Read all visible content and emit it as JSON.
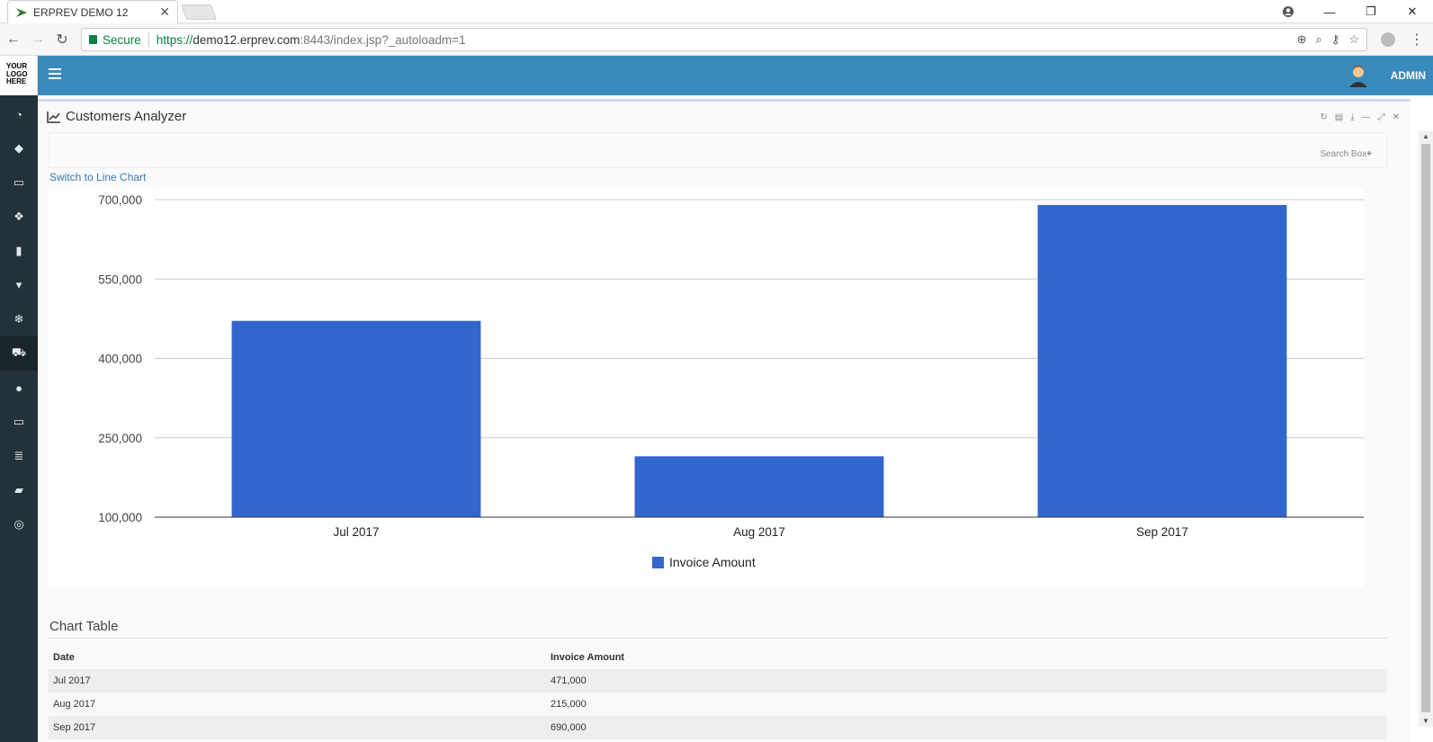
{
  "browser": {
    "tab_title": "ERPREV DEMO 12",
    "secure_label": "Secure",
    "url_scheme": "https://",
    "url_host": "demo12.erprev.com",
    "url_rest": ":8443/index.jsp?_autoloadm=1"
  },
  "app": {
    "logo_lines": [
      "YOUR",
      "LOGO",
      "HERE"
    ],
    "user_label": "ADMIN",
    "accent_color": "#3a8bbd",
    "sidebar_icons": [
      "dashboard-icon",
      "tag-icon",
      "money-icon",
      "cubes-icon",
      "building-icon",
      "trash-icon",
      "snowflake-icon",
      "cart-icon",
      "circle-icon",
      "desktop-icon",
      "database-icon",
      "book-icon",
      "lifebuoy-icon"
    ]
  },
  "panel": {
    "title": "Customers Analyzer",
    "search_box_label": "Search Box",
    "switch_link": "Switch to Line Chart"
  },
  "chart_data": {
    "type": "bar",
    "categories": [
      "Jul 2017",
      "Aug 2017",
      "Sep 2017"
    ],
    "series": [
      {
        "name": "Invoice Amount",
        "values": [
          471000,
          215000,
          690000
        ],
        "color": "#3366cc"
      }
    ],
    "ylim": [
      100000,
      700000
    ],
    "yticks": [
      100000,
      250000,
      400000,
      550000,
      700000
    ],
    "ytick_labels": [
      "100,000",
      "250,000",
      "400,000",
      "550,000",
      "700,000"
    ],
    "legend_position": "bottom",
    "grid": true
  },
  "table": {
    "title": "Chart Table",
    "headers": [
      "Date",
      "Invoice Amount"
    ],
    "rows": [
      [
        "Jul 2017",
        "471,000"
      ],
      [
        "Aug 2017",
        "215,000"
      ],
      [
        "Sep 2017",
        "690,000"
      ]
    ]
  }
}
